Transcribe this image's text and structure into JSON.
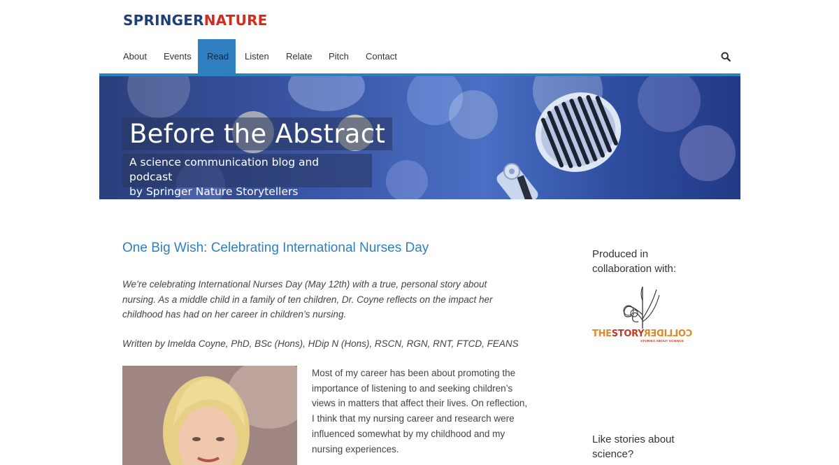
{
  "brand": {
    "part1": "SPRINGER",
    "part2": "NATURE"
  },
  "nav": {
    "items": [
      {
        "label": "About",
        "active": false
      },
      {
        "label": "Events",
        "active": false
      },
      {
        "label": "Read",
        "active": true
      },
      {
        "label": "Listen",
        "active": false
      },
      {
        "label": "Relate",
        "active": false
      },
      {
        "label": "Pitch",
        "active": false
      },
      {
        "label": "Contact",
        "active": false
      }
    ],
    "search_icon": "search-icon"
  },
  "banner": {
    "title": "Before the Abstract",
    "subtitle_line1": "A science communication blog and podcast",
    "subtitle_line2": "by Springer Nature Storytellers"
  },
  "post": {
    "title": "One Big Wish: Celebrating International Nurses Day",
    "intro": "We’re celebrating International Nurses Day (May 12th) with a true, personal story about nursing. As a middle child in a family of ten children, Dr. Coyne reflects on the impact her childhood has had on her career in children’s nursing.",
    "byline": "Written by Imelda Coyne, PhD, BSc (Hons), HDip N (Hons), RSCN, RGN, RNT, FTCD, FEANS",
    "body": "Most of my career has been about promoting the importance of listening to and seeking children’s views in matters that affect their lives. On reflection, I think that my nursing career and research were influenced somewhat by my childhood and my nursing experiences."
  },
  "sidebar": {
    "collab_heading_line1": "Produced in",
    "collab_heading_line2": "collaboration with:",
    "logo": {
      "the": "THE",
      "story": "STORY",
      "collider": "COLLIDER",
      "tagline": "STORIES ABOUT SCIENCE"
    },
    "stories_heading_line1": "Like stories about",
    "stories_heading_line2": "science?"
  },
  "colors": {
    "accent": "#2f7fc1",
    "brand_blue": "#1f3f7a",
    "brand_red": "#d52b1e"
  }
}
